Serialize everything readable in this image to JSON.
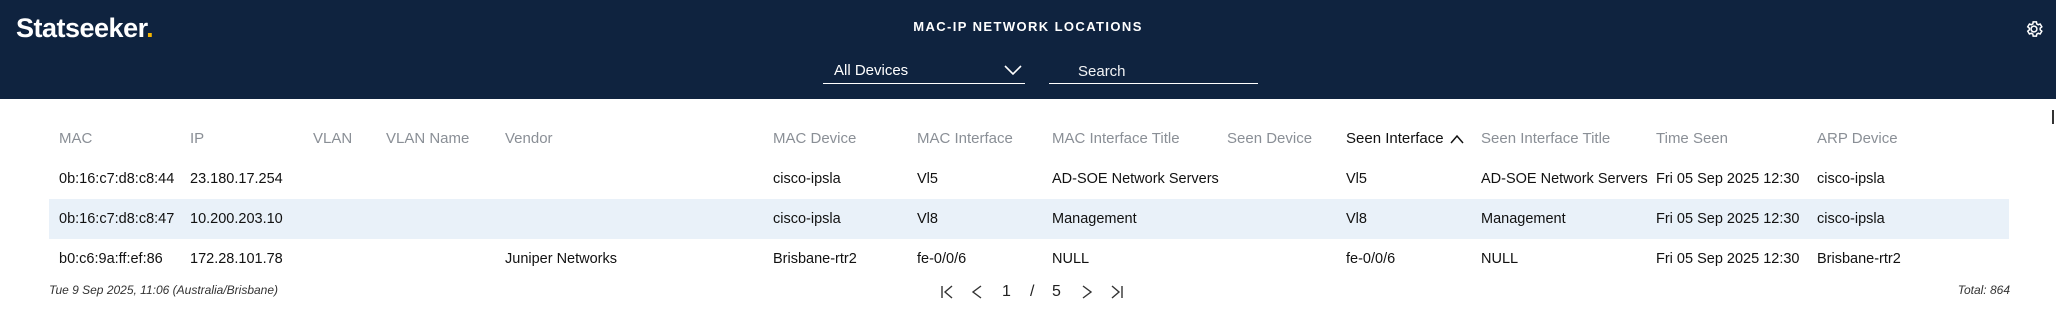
{
  "header": {
    "logo_text": "Statseeker",
    "logo_dot": ".",
    "title": "MAC-IP NETWORK LOCATIONS",
    "settings_icon": "gear-icon",
    "device_select": {
      "value": "All Devices",
      "icon": "chevron-down-icon"
    },
    "search": {
      "placeholder": "Search",
      "value": ""
    }
  },
  "table": {
    "columns": [
      "MAC",
      "IP",
      "VLAN",
      "VLAN Name",
      "Vendor",
      "MAC Device",
      "MAC Interface",
      "MAC Interface Title",
      "Seen Device",
      "Seen Interface",
      "Seen Interface Title",
      "Time Seen",
      "ARP Device"
    ],
    "sorted_column": "Seen Interface",
    "sort_direction": "ascending",
    "rows": [
      [
        "0b:16:c7:d8:c8:44",
        "23.180.17.254",
        "",
        "",
        "",
        "cisco-ipsla",
        "Vl5",
        "AD-SOE Network Servers",
        "",
        "Vl5",
        "AD-SOE Network Servers",
        "Fri 05 Sep 2025 12:30",
        "cisco-ipsla"
      ],
      [
        "0b:16:c7:d8:c8:47",
        "10.200.203.10",
        "",
        "",
        "",
        "cisco-ipsla",
        "Vl8",
        "Management",
        "",
        "Vl8",
        "Management",
        "Fri 05 Sep 2025 12:30",
        "cisco-ipsla"
      ],
      [
        "b0:c6:9a:ff:ef:86",
        "172.28.101.78",
        "",
        "",
        "Juniper Networks",
        "Brisbane-rtr2",
        "fe-0/0/6",
        "NULL",
        "",
        "fe-0/0/6",
        "NULL",
        "Fri 05 Sep 2025 12:30",
        "Brisbane-rtr2"
      ]
    ]
  },
  "footer": {
    "timestamp": "Tue 9 Sep 2025, 11:06 (Australia/Brisbane)",
    "pager": {
      "current_page": "1",
      "separator": "/",
      "total_pages": "5"
    },
    "total": "Total: 864"
  },
  "colors": {
    "header_bg": "#0f233f",
    "accent_dot": "#f4b400",
    "row_alt_bg": "#e9f1f9",
    "header_text_muted": "#8a8f96"
  }
}
